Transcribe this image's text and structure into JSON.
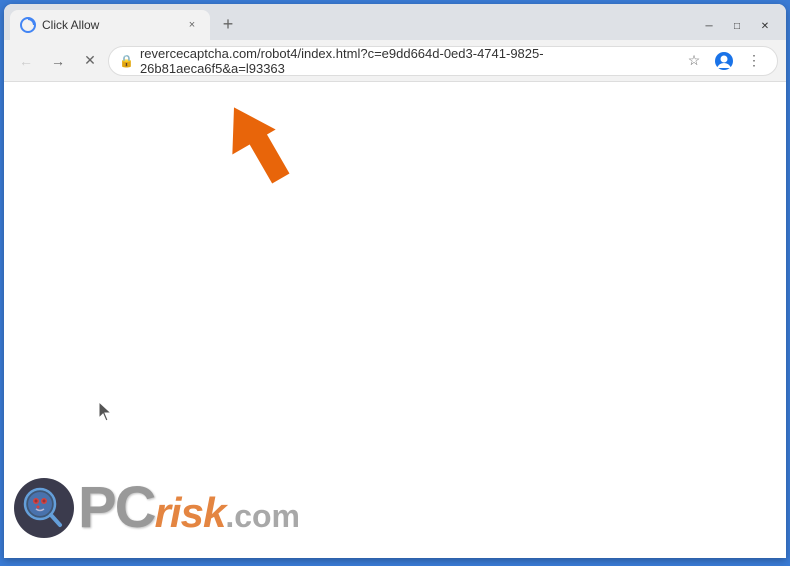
{
  "window": {
    "title": "Click Allow",
    "url": "revercecaptcha.com/robot4/index.html?c=e9dd664d-0ed3-4741-9825-26b81aeca6f5&a=l93363",
    "new_tab_label": "+",
    "tab_close_label": "×"
  },
  "nav": {
    "back_label": "←",
    "forward_label": "→",
    "reload_label": "✕",
    "lock_symbol": "🔒"
  },
  "window_controls": {
    "minimize": "─",
    "maximize": "□",
    "close": "✕"
  },
  "watermark": {
    "brand": "PC",
    "suffix": "risk",
    "tld": ".com"
  }
}
